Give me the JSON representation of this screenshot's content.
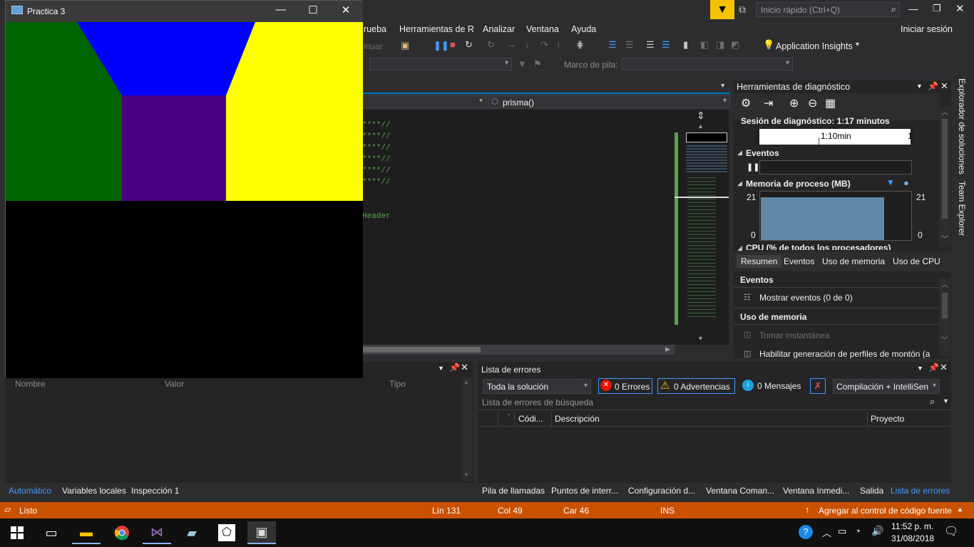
{
  "vs": {
    "quick_launch_placeholder": "Inicio rápido (Ctrl+Q)",
    "menu": [
      "rueba",
      "Herramientas de R",
      "Analizar",
      "Ventana",
      "Ayuda"
    ],
    "sign_in": "Iniciar sesión",
    "toolbar": {
      "continue_label": "inuar",
      "app_insights": "Application Insights"
    },
    "stack_frame_label": "Marco de pila:",
    "nav_function": "prisma()",
    "code_lines": [
      "****//",
      "****//",
      "****//",
      "****//",
      "****//",
      "****//",
      "Header"
    ]
  },
  "diagnostics": {
    "title": "Herramientas de diagnóstico",
    "session": "Sesión de diagnóstico: 1:17 minutos",
    "timeline_label": "1:10min",
    "timeline_right": "1",
    "events_label": "Eventos",
    "memory_label": "Memoria de proceso (MB)",
    "mem_max_left": "21",
    "mem_min_left": "0",
    "mem_max_right": "21",
    "mem_min_right": "0",
    "cpu_label": "CPU (% de todos los procesadores)",
    "tabs": [
      "Resumen",
      "Eventos",
      "Uso de memoria",
      "Uso de CPU"
    ],
    "section_events": "Eventos",
    "show_events": "Mostrar eventos (0 de 0)",
    "section_memory": "Uso de memoria",
    "take_snapshot": "Tomar instantánea",
    "heap_profiling": "Habilitar generación de perfiles de montón (a"
  },
  "side_tabs": [
    "Explorador de soluciones",
    "Team Explorer"
  ],
  "locals": {
    "columns": [
      "Nombre",
      "Valor",
      "Tipo"
    ],
    "tabs": [
      "Automático",
      "Variables locales",
      "Inspección 1"
    ]
  },
  "errors": {
    "title": "Lista de errores",
    "scope": "Toda la solución",
    "errors_btn": "0 Errores",
    "warnings_btn": "0 Advertencias",
    "messages_btn": "0 Mensajes",
    "build_filter": "Compilación + IntelliSen",
    "search_placeholder": "Lista de errores de búsqueda",
    "columns": [
      "Códi...",
      "Descripción",
      "Proyecto"
    ],
    "tabs": [
      "Pila de llamadas",
      "Puntos de interr...",
      "Configuración d...",
      "Ventana Coman...",
      "Ventana Inmedi...",
      "Salida",
      "Lista de errores"
    ]
  },
  "status": {
    "ready": "Listo",
    "line": "Lín 131",
    "col": "Col 49",
    "car": "Car 46",
    "ins": "INS",
    "source_control": "Agregar al control de código fuente"
  },
  "taskbar": {
    "time": "11:52 p. m.",
    "date": "31/08/2018"
  },
  "app_window": {
    "title": "Practica 3",
    "colors": {
      "green": "#006400",
      "blue": "#0000ff",
      "yellow": "#ffff00",
      "purple": "#4b0082",
      "background": "#000000"
    }
  }
}
